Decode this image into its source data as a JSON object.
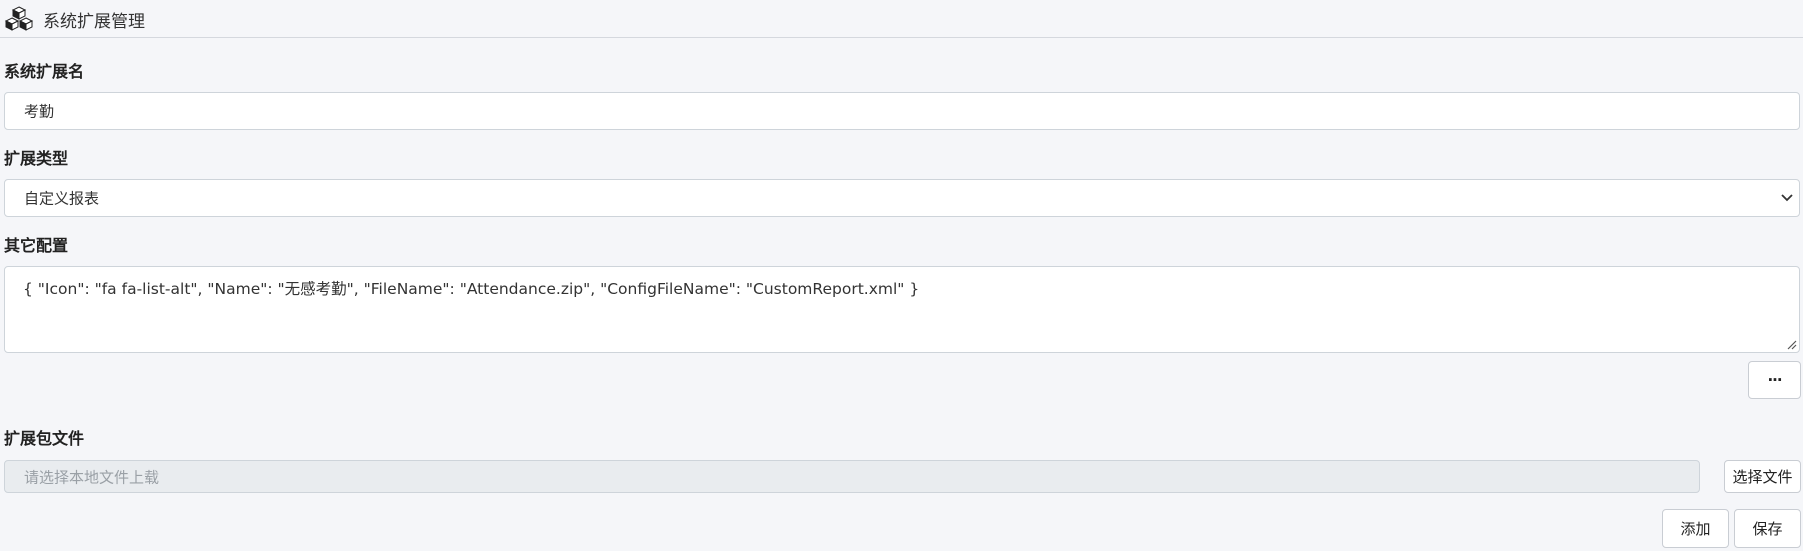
{
  "header": {
    "title": "系统扩展管理",
    "icon": "cubes-icon"
  },
  "form": {
    "name_label": "系统扩展名",
    "name_value": "考勤",
    "type_label": "扩展类型",
    "type_value": "自定义报表",
    "config_label": "其它配置",
    "config_value": "{ \"Icon\": \"fa fa-list-alt\", \"Name\": \"无感考勤\", \"FileName\": \"Attendance.zip\", \"ConfigFileName\": \"CustomReport.xml\" }",
    "more_button": "···",
    "file_label": "扩展包文件",
    "file_placeholder": "请选择本地文件上载",
    "choose_file_button": "选择文件",
    "add_button": "添加",
    "save_button": "保存"
  },
  "colors": {
    "background": "#f5f6f9",
    "border": "#ced4da",
    "disabled": "#e9ecef"
  }
}
